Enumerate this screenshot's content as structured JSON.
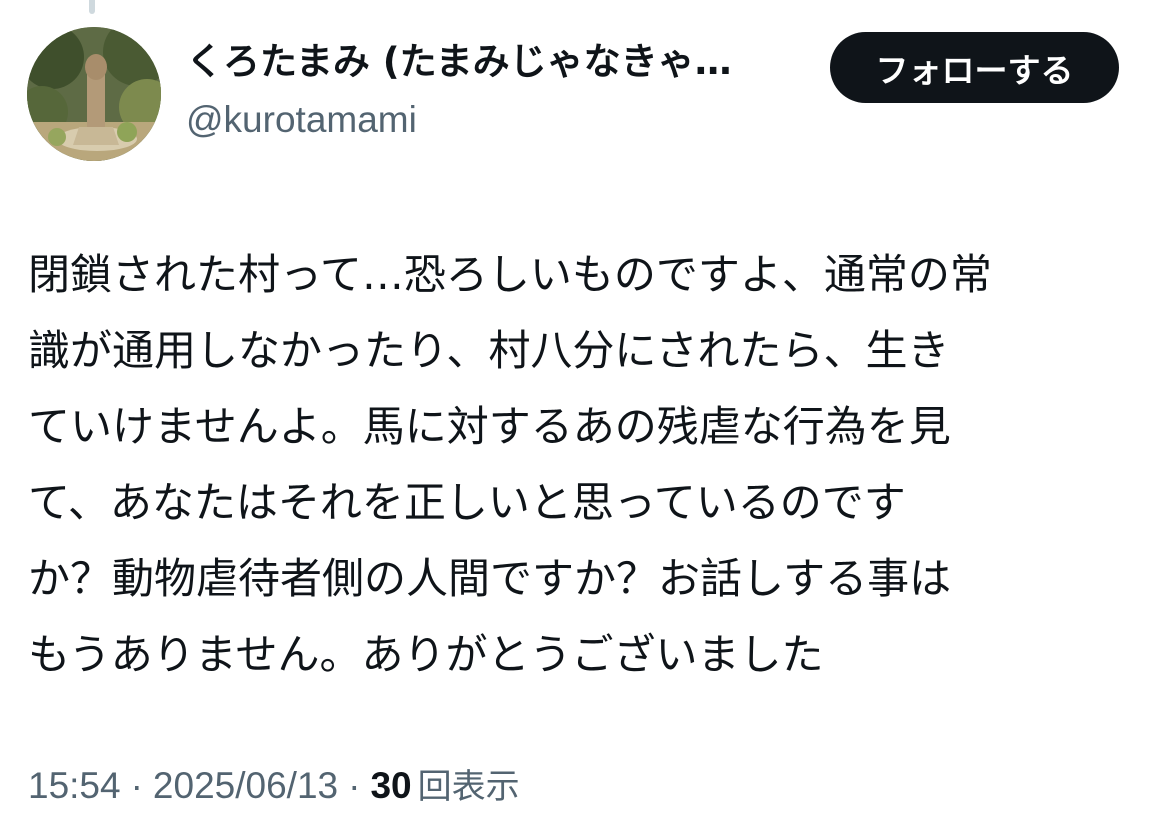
{
  "tweet": {
    "author": {
      "display_name": "くろたまみ (たまみじゃなきゃ…",
      "handle": "@kurotamami"
    },
    "follow_button_label": "フォローする",
    "text_lines": [
      "閉鎖された村って…恐ろしいものですよ、通常の常",
      "識が通用しなかったり、村八分にされたら、生き",
      "ていけませんよ。馬に対するあの残虐な行為を見",
      "て、あなたはそれを正しいと思っているのです",
      "か？動物虐待者側の人間ですか？お話しする事は",
      "もうありません。ありがとうございました"
    ],
    "meta": {
      "time": "15:54",
      "separator": "·",
      "date": "2025/06/13",
      "views_count": "30",
      "views_label": "回表示"
    }
  },
  "colors": {
    "text_primary": "#0f1419",
    "text_secondary": "#536471",
    "button_bg": "#0f1419",
    "button_text": "#ffffff",
    "thread_line": "#cfd9de"
  },
  "icons": {
    "avatar": "avatar-photo-statue-in-garden"
  }
}
